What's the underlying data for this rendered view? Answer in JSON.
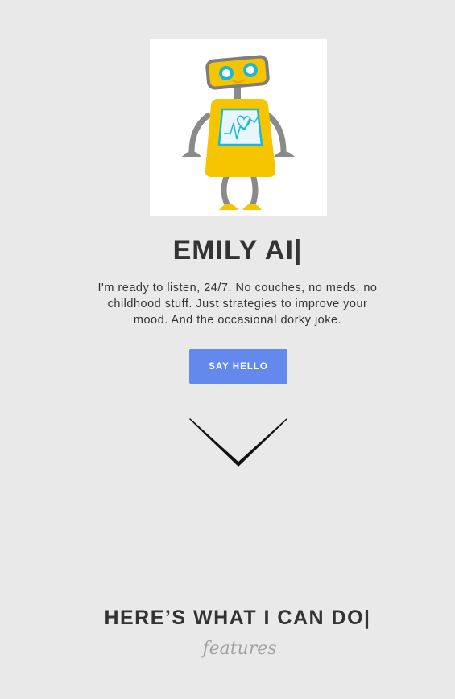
{
  "hero": {
    "title": "EMILY AI",
    "cursor": "|",
    "description": "I'm ready to listen, 24/7. No couches, no meds, no childhood stuff. Just strategies to improve your mood. And the occasional dorky joke.",
    "cta_label": "SAY HELLO",
    "mascot_icon": "robot-mascot",
    "scroll_icon": "chevron-down-icon"
  },
  "features_section": {
    "title": "HERE’S WHAT I CAN DO",
    "cursor": "|",
    "subtitle": "features"
  },
  "colors": {
    "background": "#e9e9e9",
    "accent": "#6389ec",
    "text": "#333333",
    "robot_yellow": "#f6c500",
    "robot_gray": "#8a8a8a",
    "robot_cyan": "#19b9d6"
  }
}
